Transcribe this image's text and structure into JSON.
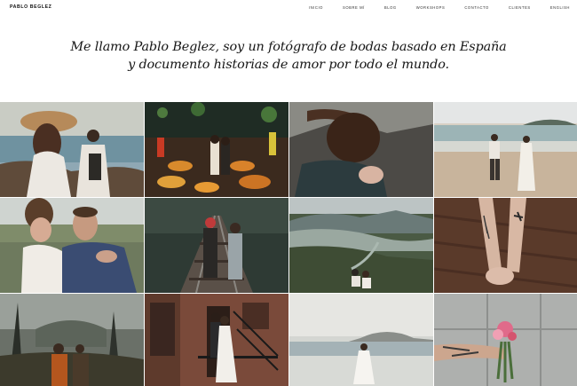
{
  "header": {
    "logo": "PABLO BEGLEZ",
    "nav": [
      "INICIO",
      "SOBRE MÍ",
      "BLOG",
      "WORKSHOPS",
      "CONTACTO",
      "CLIENTES",
      "ENGLISH"
    ]
  },
  "intro": {
    "line1": "Me llamo Pablo Beglez, soy un fotógrafo de bodas basado en España",
    "line2": "y documento historias de amor por todo el mundo."
  },
  "colors": {
    "background": "#ffffff",
    "text": "#111111"
  }
}
